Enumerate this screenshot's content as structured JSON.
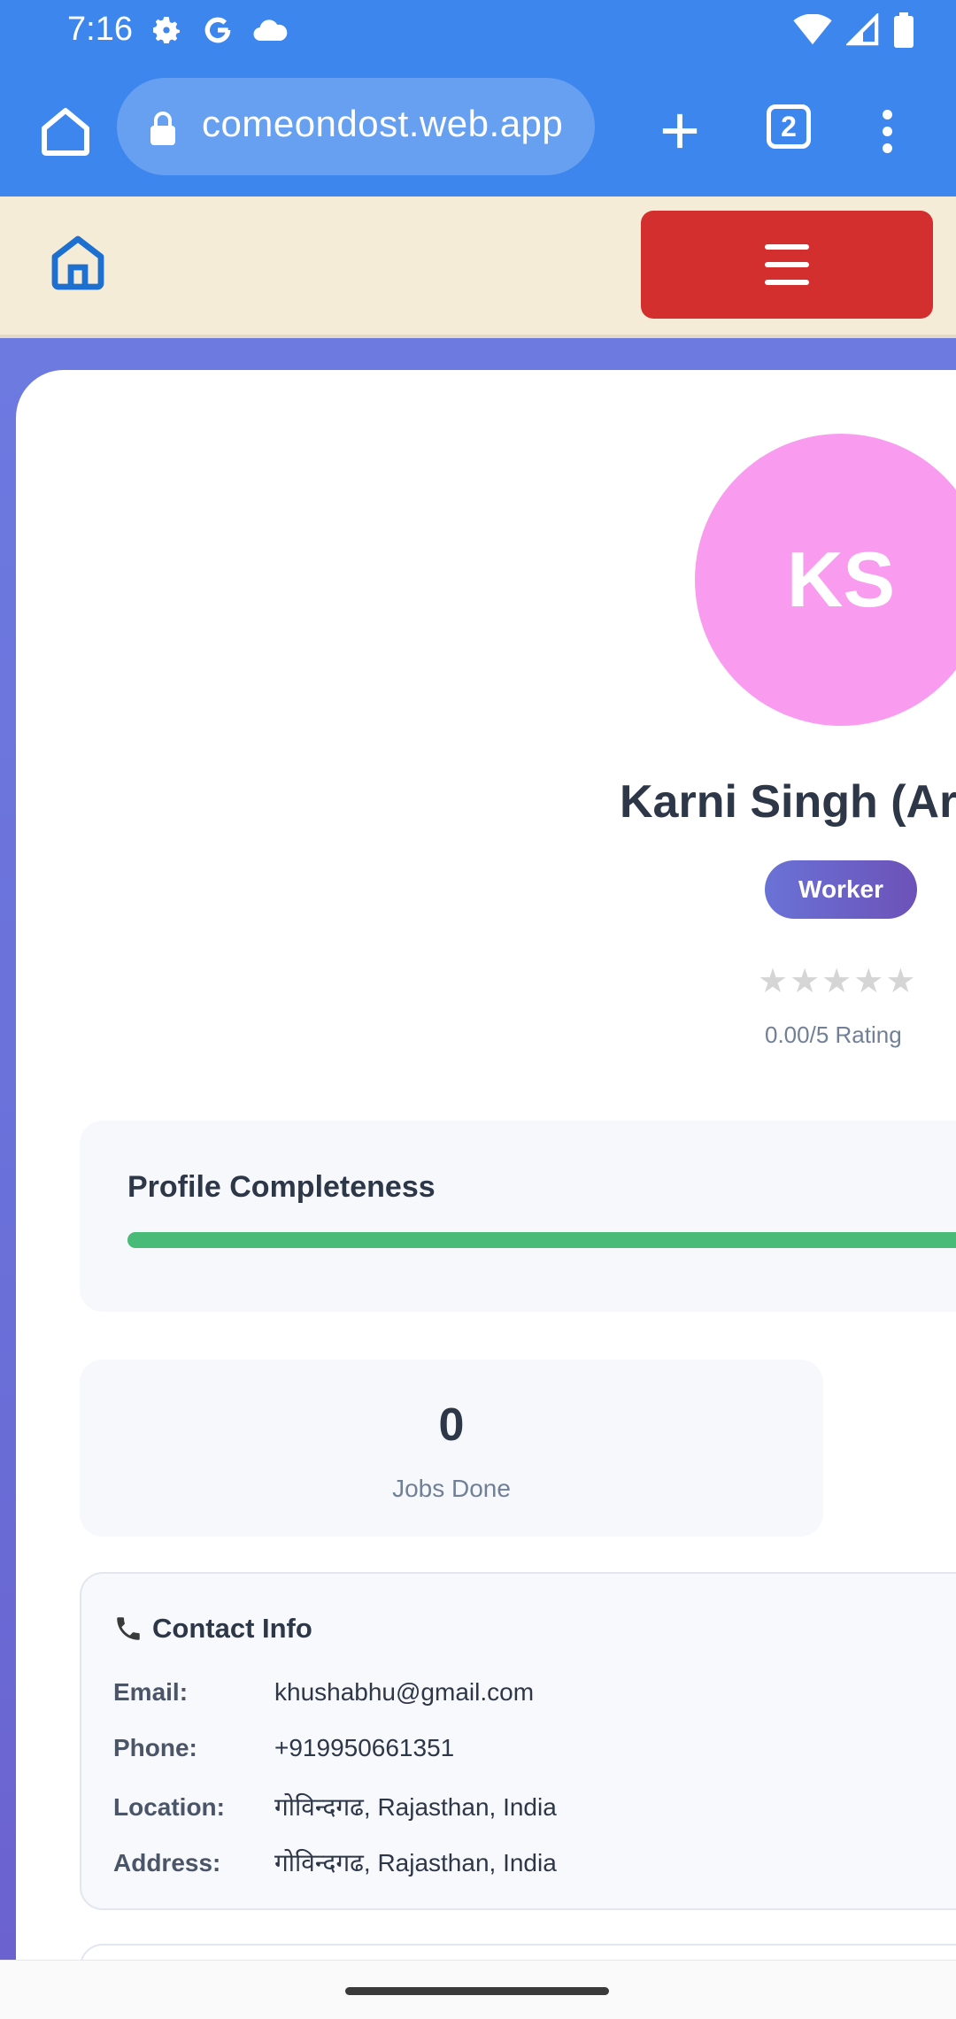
{
  "status_bar": {
    "time": "7:16"
  },
  "browser": {
    "url": "comeondost.web.app",
    "tab_count": "2"
  },
  "site_header": {
    "menu_label": ""
  },
  "profile": {
    "avatar_initials": "KS",
    "name": "Karni Singh (Ars",
    "role": "Worker",
    "stars": [
      "★",
      "★",
      "★",
      "★",
      "★"
    ],
    "rating_value": 0,
    "rating_text": "0.00/5 Rating"
  },
  "completeness": {
    "title": "Profile Completeness",
    "progress_percent": 100,
    "progress_color": "#48bb78"
  },
  "stats": {
    "jobs_done_value": "0",
    "jobs_done_label": "Jobs Done"
  },
  "contact": {
    "icon": "phone-icon",
    "title": "Contact Info",
    "rows": [
      {
        "label": "Email:",
        "value": "khushabhu@gmail.com"
      },
      {
        "label": "Phone:",
        "value": "+919950661351"
      },
      {
        "label": "Location:",
        "value": "गोविन्दगढ, Rajasthan, India"
      },
      {
        "label": "Address:",
        "value": "गोविन्दगढ, Rajasthan, India"
      }
    ]
  },
  "colors": {
    "browser_blue": "#3d86ee",
    "header_bg": "#f5ecd7",
    "menu_red": "#d32f2f",
    "avatar_pink": "#f99cf0",
    "badge_purple": "#6c52b8"
  }
}
